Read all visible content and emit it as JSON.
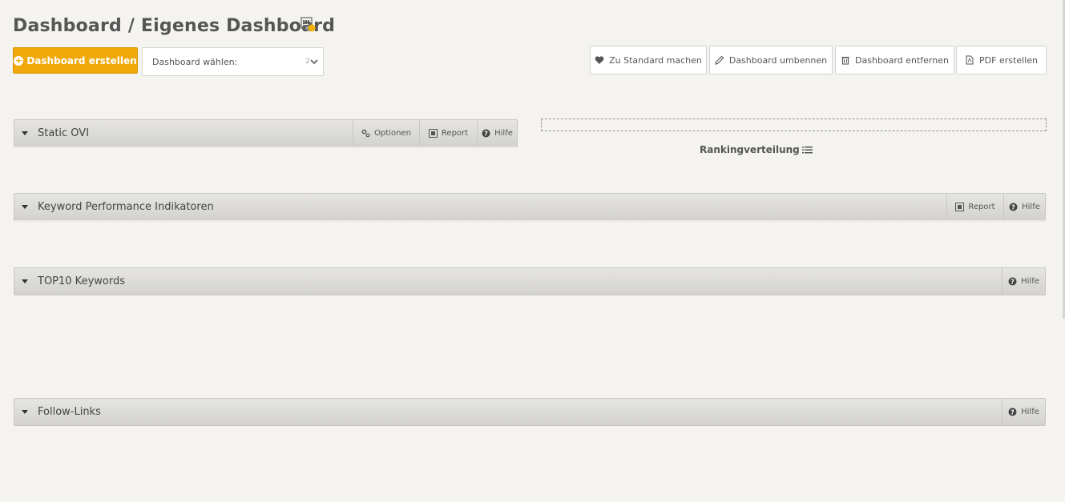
{
  "header": {
    "title": "Dashboard / Eigenes Dashboard",
    "title_icon": "dashboard-badge-icon"
  },
  "toolbar": {
    "create_label": "Dashboard erstellen",
    "select_label": "Dashboard wählen:",
    "select_value": "2",
    "default_label": "Zu Standard machen",
    "rename_label": "Dashboard umbennen",
    "remove_label": "Dashboard entfernen",
    "pdf_label": "PDF erstellen"
  },
  "widgets": {
    "static_ovi": {
      "title": "Static OVI",
      "options_label": "Optionen",
      "report_label": "Report",
      "help_label": "Hilfe"
    },
    "ranking": {
      "title": "Rankingverteilung"
    },
    "kpi": {
      "title": "Keyword Performance Indikatoren",
      "report_label": "Report",
      "help_label": "Hilfe"
    },
    "top10": {
      "title": "TOP10 Keywords",
      "help_label": "Hilfe"
    },
    "follow": {
      "title": "Follow-Links",
      "help_label": "Hilfe"
    }
  },
  "colors": {
    "accent": "#f0a80a",
    "background": "#f4f3ef"
  }
}
